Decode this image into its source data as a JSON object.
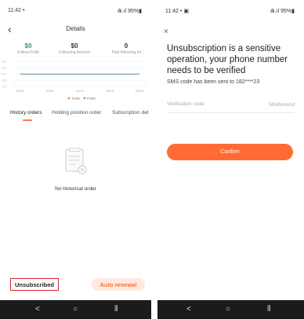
{
  "left": {
    "status": {
      "time": "11:42",
      "dot": "•",
      "signal": "⋒.ıl",
      "battery": "95%▮"
    },
    "title": "Details",
    "stats": [
      {
        "value": "$0",
        "label": "Follow Profit"
      },
      {
        "value": "$0",
        "label": "Following Amount"
      },
      {
        "value": "0",
        "label": "Total following lot"
      }
    ],
    "chart_data": {
      "type": "line",
      "categories": [
        "01/10",
        "01/11",
        "01/12",
        "01/13",
        "01/14"
      ],
      "y_ticks": [
        "1.0",
        "0.5",
        "0.0",
        "-0.5",
        "-1.0"
      ],
      "series": [
        {
          "name": "Trader",
          "color": "#ff8a3d",
          "values": [
            0,
            0,
            0,
            0,
            0
          ]
        },
        {
          "name": "Profile",
          "color": "#5aa7d8",
          "values": [
            0,
            0,
            0,
            0,
            0
          ]
        }
      ],
      "ylim": [
        -1.0,
        1.0
      ]
    },
    "tabs": [
      "History orders",
      "Holding position order",
      "Subscription det"
    ],
    "empty_text": "No historical order",
    "unsubscribed": "Unsubscribed",
    "auto_renewal": "Auto renewal",
    "nav": [
      "<",
      "○",
      "⦀"
    ]
  },
  "right": {
    "status": {
      "time": "11:42",
      "dot": "•",
      "gallery": "▣",
      "signal": "⋒.ıl",
      "battery": "95%▮"
    },
    "close": "×",
    "heading": "Unsubscription is a sensitive operation, your phone number needs to be verified",
    "sms": "SMS code has been sent to 182****23",
    "code_placeholder": "Verification code",
    "resend": "58sResend",
    "confirm": "Confirm",
    "nav": [
      "<",
      "○",
      "⦀"
    ]
  }
}
